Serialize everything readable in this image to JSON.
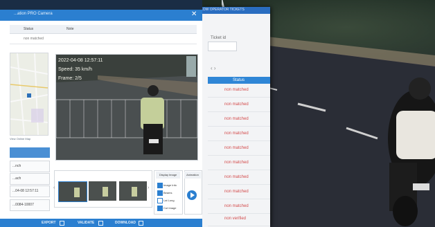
{
  "dialog": {
    "title": "...ation PRO Camera",
    "close_glyph": "✕",
    "table": {
      "headers": {
        "status": "Status",
        "note": "Note"
      },
      "row": {
        "status": "non matched"
      }
    },
    "map_caption": "View Online Map",
    "fields": [
      "",
      "...nch",
      "...ach",
      "...04-08 12:57:11",
      "...0084-10007"
    ],
    "video": {
      "timestamp": "2022-04-08 12:57:11",
      "speed": "Speed: 35 km/h",
      "frame": "Frame: 2/5"
    },
    "display_image": {
      "title": "Display Image",
      "options": [
        {
          "label": "Image Info",
          "checked": true
        },
        {
          "label": "Beams",
          "checked": true
        },
        {
          "label": "Lat Long",
          "checked": false
        },
        {
          "label": "Cut Image",
          "checked": true
        }
      ]
    },
    "animation": {
      "title": "Animation"
    },
    "thumb_prev": "‹",
    "thumb_next": "›",
    "bottom_buttons": {
      "export": "EXPORT",
      "validate": "VALIDATE",
      "download": "DOWNLOAD"
    }
  },
  "back_window": {
    "title_fragment": "LOW OPERATOR TICKETS",
    "ticket_label": "Ticket id",
    "arrows": "‹  ›",
    "column_header": "Status",
    "rows": [
      "non matched",
      "non matched",
      "non matched",
      "non matched",
      "non matched",
      "non matched",
      "non matched",
      "non matched",
      "non matched",
      "non verified"
    ]
  },
  "colors": {
    "accent": "#2b7fd0",
    "status_red": "#d34b4b"
  }
}
